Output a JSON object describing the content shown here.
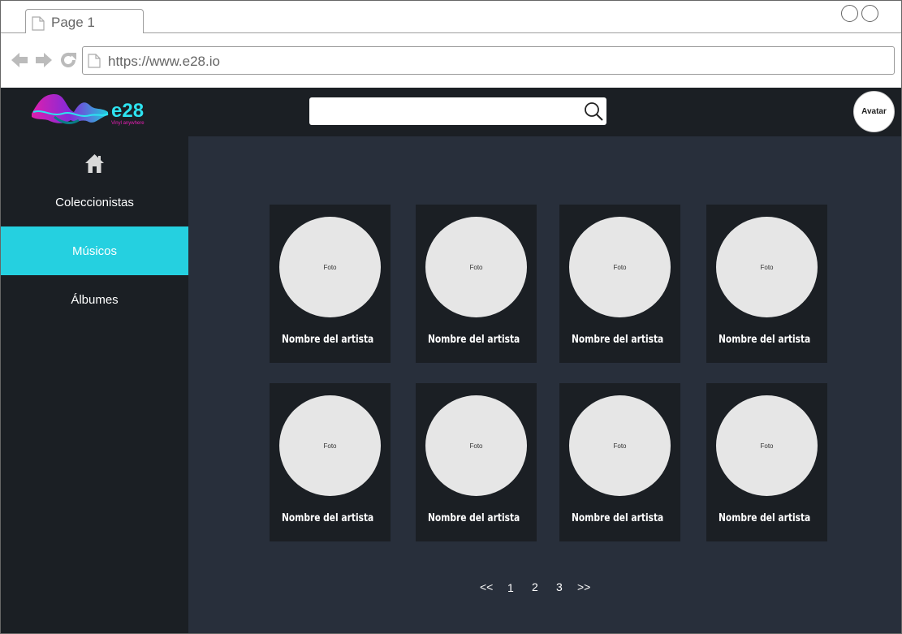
{
  "browser": {
    "tab_title": "Page 1",
    "url": "https://www.e28.io"
  },
  "header": {
    "logo_text": "e28",
    "logo_tagline": "Vinyl anywhere",
    "search_value": "",
    "avatar_label": "Avatar"
  },
  "sidebar": {
    "items": [
      {
        "label": "Coleccionistas",
        "active": false
      },
      {
        "label": "Músicos",
        "active": true
      },
      {
        "label": "Álbumes",
        "active": false
      }
    ]
  },
  "main": {
    "cards": [
      {
        "photo_label": "Foto",
        "name": "Nombre del artista"
      },
      {
        "photo_label": "Foto",
        "name": "Nombre del artista"
      },
      {
        "photo_label": "Foto",
        "name": "Nombre del artista"
      },
      {
        "photo_label": "Foto",
        "name": "Nombre del artista"
      },
      {
        "photo_label": "Foto",
        "name": "Nombre del artista"
      },
      {
        "photo_label": "Foto",
        "name": "Nombre del artista"
      },
      {
        "photo_label": "Foto",
        "name": "Nombre del artista"
      },
      {
        "photo_label": "Foto",
        "name": "Nombre del artista"
      }
    ],
    "pagination": {
      "first": "<<",
      "pages": [
        "1",
        "2",
        "3"
      ],
      "last": ">>"
    }
  },
  "colors": {
    "header_bg": "#1b1f24",
    "main_bg": "#282f3b",
    "accent": "#25d0e0",
    "card_bg": "#1b1f24",
    "photo_bg": "#e6e6e6"
  },
  "icons": [
    "document-icon",
    "back-arrow-icon",
    "forward-arrow-icon",
    "reload-icon",
    "search-icon",
    "home-icon"
  ]
}
